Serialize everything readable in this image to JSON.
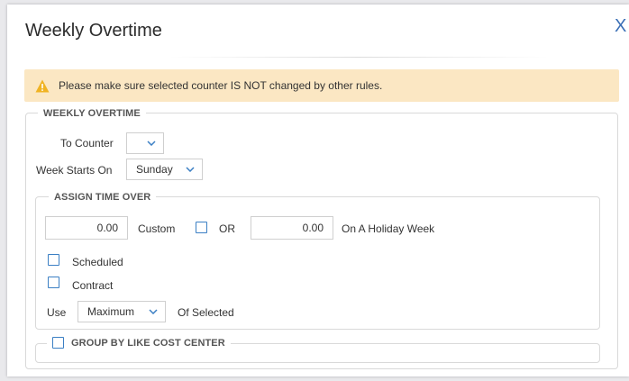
{
  "dialog": {
    "title": "Weekly Overtime",
    "close_icon": "close-icon",
    "close_glyph": "X"
  },
  "warning": {
    "icon": "warning-icon",
    "text": "Please make sure selected counter IS NOT changed by other rules."
  },
  "weekly_overtime": {
    "legend": "WEEKLY OVERTIME",
    "to_counter_label": "To Counter",
    "to_counter_value": "",
    "week_starts_label": "Week Starts On",
    "week_starts_value": "Sunday"
  },
  "assign_time_over": {
    "legend": "ASSIGN TIME OVER",
    "hours_value": "0.00",
    "custom_label": "Custom",
    "custom_checked": false,
    "or_label": "OR",
    "holiday_hours_value": "0.00",
    "holiday_label": "On A Holiday Week",
    "scheduled_label": "Scheduled",
    "scheduled_checked": false,
    "contract_label": "Contract",
    "contract_checked": false,
    "use_label": "Use",
    "use_value": "Maximum",
    "of_selected_label": "Of Selected"
  },
  "group_by": {
    "label": "GROUP BY LIKE COST CENTER",
    "checked": false
  },
  "colors": {
    "accent": "#3b7fc4",
    "warning_bg": "#fbe7c3",
    "warning_icon": "#f0b323",
    "border": "#d9d9d9"
  }
}
